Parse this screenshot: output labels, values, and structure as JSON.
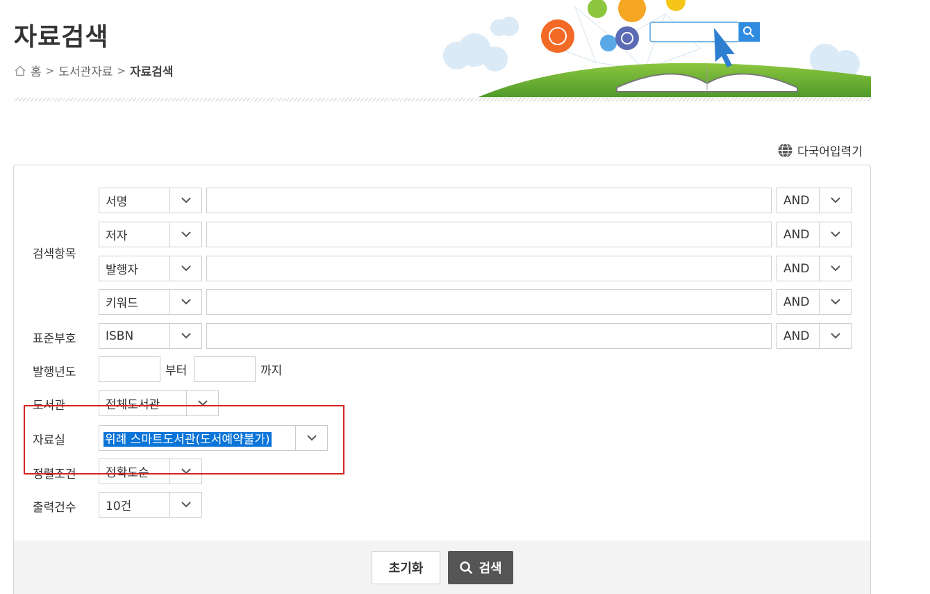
{
  "header": {
    "title": "자료검색",
    "breadcrumb": [
      "홈",
      "도서관자료",
      "자료검색"
    ],
    "breadcrumb_sep": ">"
  },
  "ime": {
    "label": "다국어입력기"
  },
  "form": {
    "label_search_items": "검색항목",
    "search_rows": [
      {
        "field": "서명",
        "value": "",
        "operator": "AND"
      },
      {
        "field": "저자",
        "value": "",
        "operator": "AND"
      },
      {
        "field": "발행자",
        "value": "",
        "operator": "AND"
      },
      {
        "field": "키워드",
        "value": "",
        "operator": "AND"
      }
    ],
    "label_std_no": "표준부호",
    "std_row": {
      "field": "ISBN",
      "value": "",
      "operator": "AND"
    },
    "label_year": "발행년도",
    "year_from_suffix": "부터",
    "year_to_suffix": "까지",
    "label_library": "도서관",
    "library_value": "전체도서관",
    "label_room": "자료실",
    "room_value": "위례 스마트도서관(도서예약불가)",
    "label_sort": "정렬조건",
    "sort_value": "정확도순",
    "label_count": "출력건수",
    "count_value": "10건"
  },
  "buttons": {
    "reset": "초기화",
    "search": "검색"
  },
  "colors": {
    "highlight": "#0a74d8",
    "annotation_box": "#d32323",
    "search_button": "#555555"
  }
}
